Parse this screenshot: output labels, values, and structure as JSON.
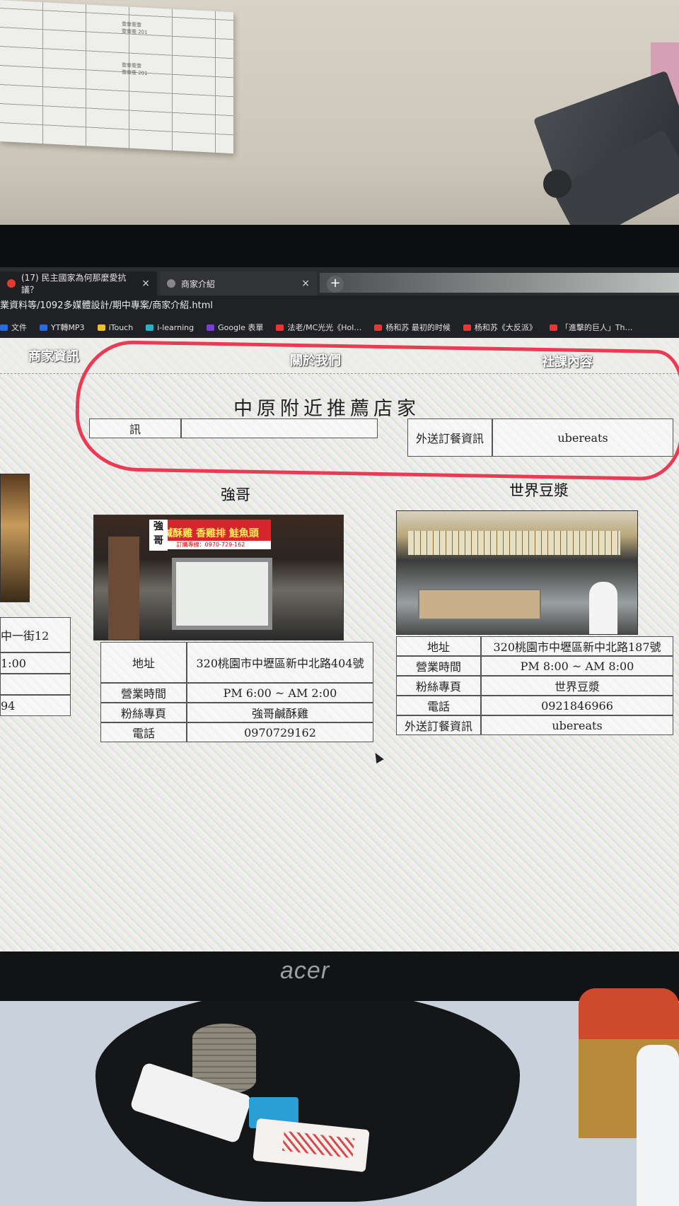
{
  "paper_lines": [
    "壹壹壹壹",
    "壹壹壹 201",
    "壹壹壹壹",
    "壹壹壹 201"
  ],
  "browser": {
    "tabs": [
      {
        "label": "(17) 民主國家為何那麼愛抗議？",
        "close": "×"
      },
      {
        "label": "商家介紹",
        "close": "×"
      }
    ],
    "new_tab": "+",
    "url": "業資料等/1092多媒體設計/期中專案/商家介紹.html",
    "bookmarks": [
      "文件",
      "YT轉MP3",
      "iTouch",
      "i-learning",
      "Google 表單",
      "法老/MC光光《Hol…",
      "杨和苏 最初的时候",
      "杨和苏《大反派》",
      "「進擊的巨人」Th…"
    ]
  },
  "page": {
    "nav": [
      "商家資訊",
      "關於我們",
      "社課內容"
    ],
    "title": "中原附近推薦店家",
    "top_left_row": {
      "label": "訊",
      "value": ""
    },
    "top_right_row": {
      "label": "外送訂餐資訊",
      "value": "ubereats"
    },
    "left_partial": {
      "rows": [
        "中一街12",
        "1:00",
        "",
        "94"
      ]
    },
    "shop1": {
      "name": "強哥",
      "sign_text": "強哥",
      "sign_banner": "鹹酥雞 香雞排 鮭魚頭",
      "sign_phone": "訂購專線：0970-729-162",
      "rows": [
        {
          "label": "地址",
          "value": "320桃園市中壢區新中北路404號"
        },
        {
          "label": "營業時間",
          "value": "PM 6:00 ~ AM 2:00"
        },
        {
          "label": "粉絲專頁",
          "value": "強哥鹹酥雞"
        },
        {
          "label": "電話",
          "value": "0970729162"
        }
      ]
    },
    "shop2": {
      "name": "世界豆漿",
      "rows": [
        {
          "label": "地址",
          "value": "320桃園市中壢區新中北路187號"
        },
        {
          "label": "營業時間",
          "value": "PM 8:00 ~ AM 8:00"
        },
        {
          "label": "粉絲專頁",
          "value": "世界豆漿"
        },
        {
          "label": "電話",
          "value": "0921846966"
        },
        {
          "label": "外送訂餐資訊",
          "value": "ubereats"
        }
      ]
    }
  },
  "monitor": {
    "brand": "acer"
  },
  "colors": {
    "annotation": "#ea3b55"
  }
}
